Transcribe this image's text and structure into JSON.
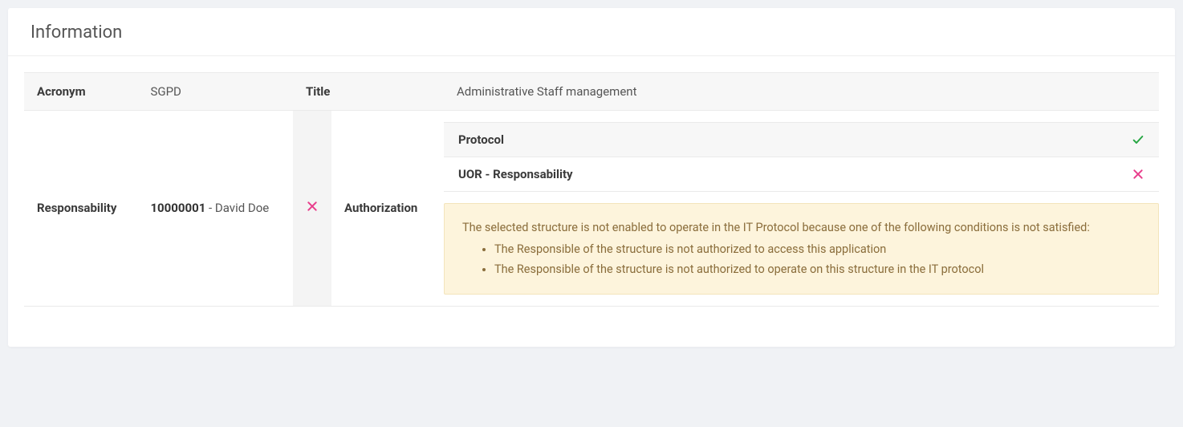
{
  "panel": {
    "title": "Information"
  },
  "header": {
    "acronym_label": "Acronym",
    "acronym_value": "SGPD",
    "title_label": "Title",
    "title_value": "Administrative Staff management"
  },
  "responsibility": {
    "label": "Responsability",
    "id": "10000001",
    "separator": " - ",
    "name": "David Doe",
    "status": "fail"
  },
  "authorization": {
    "label": "Authorization",
    "protocol": {
      "label": "Protocol",
      "status": "ok"
    },
    "uor": {
      "label": "UOR - Responsability",
      "status": "fail"
    },
    "alert": {
      "intro": "The selected structure is not enabled to operate in the IT Protocol because one of the following conditions is not satisfied:",
      "reasons": [
        "The Responsible of the structure is not authorized to access this application",
        "The Responsible of the structure is not authorized to operate on this structure in the IT protocol"
      ]
    }
  }
}
